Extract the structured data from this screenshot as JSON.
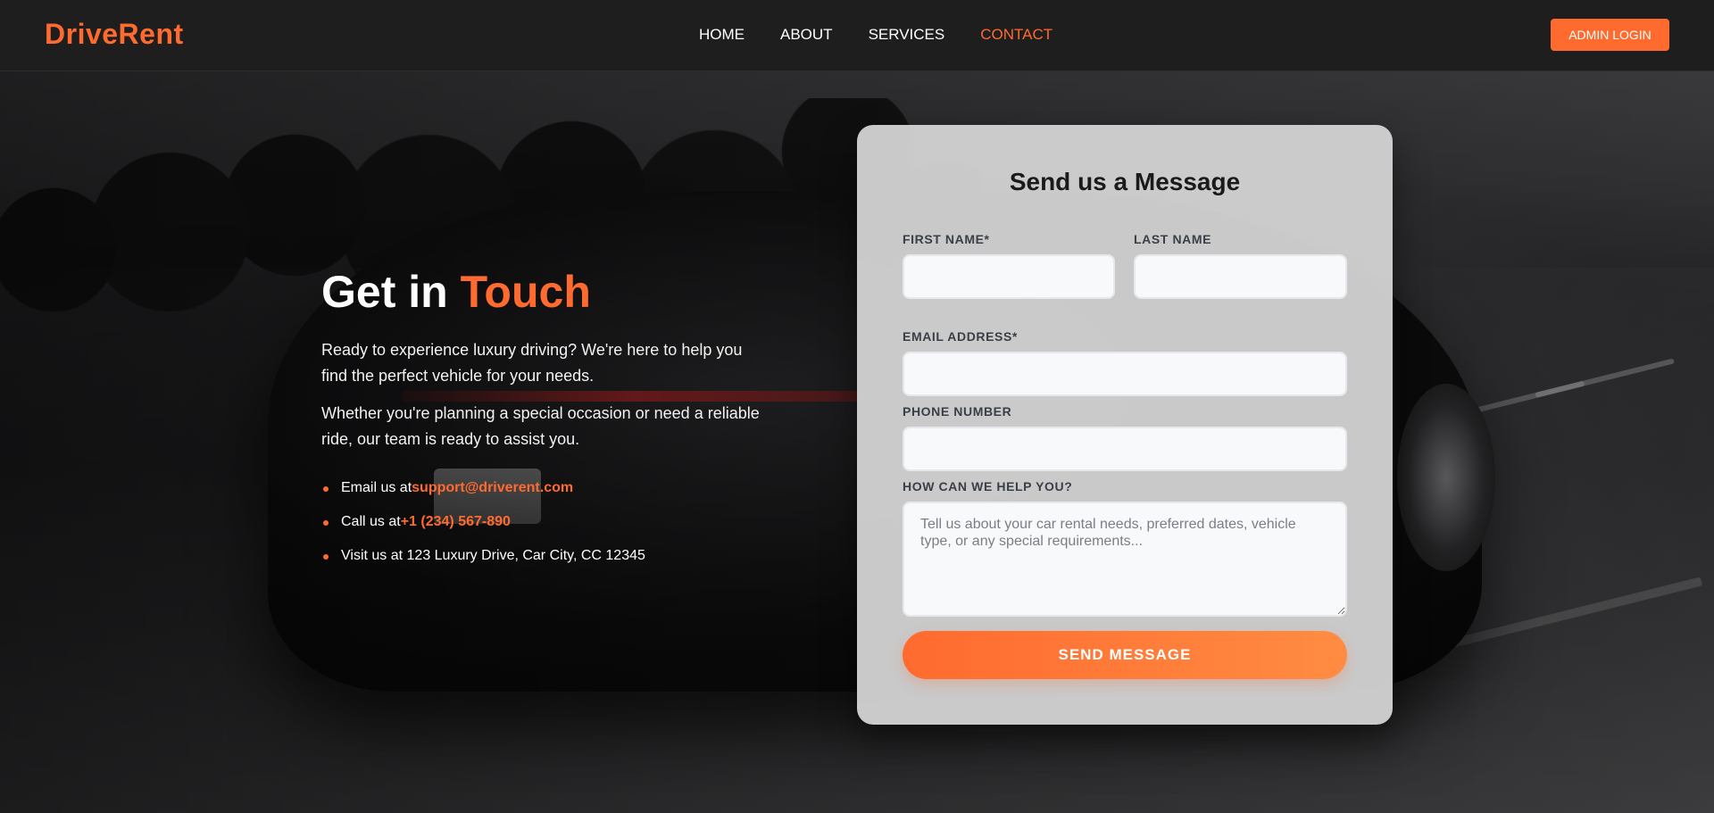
{
  "brand": {
    "logo": "DriveRent",
    "accent_color": "#ff6a2f"
  },
  "nav": {
    "items": [
      {
        "label": "HOME",
        "active": false
      },
      {
        "label": "ABOUT",
        "active": false
      },
      {
        "label": "SERVICES",
        "active": false
      },
      {
        "label": "CONTACT",
        "active": true
      }
    ],
    "admin_login": "ADMIN LOGIN"
  },
  "intro": {
    "title_prefix": "Get in",
    "title_accent": "Touch",
    "paragraphs": [
      "Ready to experience luxury driving? We're here to help you find the perfect vehicle for your needs.",
      "Whether you're planning a special occasion or need a reliable ride, our team is ready to assist you."
    ],
    "contacts": [
      {
        "prefix": "Email us at",
        "value": "support@driverent.com"
      },
      {
        "prefix": "Call us at",
        "value": "+1 (234) 567-890"
      },
      {
        "prefix": "Visit us at 123 Luxury Drive, Car City, CC 12345",
        "value": ""
      }
    ]
  },
  "form": {
    "title": "Send us a Message",
    "fields": {
      "first_name": {
        "label": "FIRST NAME*",
        "value": ""
      },
      "last_name": {
        "label": "LAST NAME",
        "value": ""
      },
      "email": {
        "label": "EMAIL ADDRESS*",
        "value": ""
      },
      "phone": {
        "label": "PHONE NUMBER",
        "value": ""
      },
      "message": {
        "label": "HOW CAN WE HELP YOU?",
        "value": "",
        "placeholder": "Tell us about your car rental needs, preferred dates, vehicle type, or any special requirements..."
      }
    },
    "submit_label": "SEND MESSAGE"
  }
}
